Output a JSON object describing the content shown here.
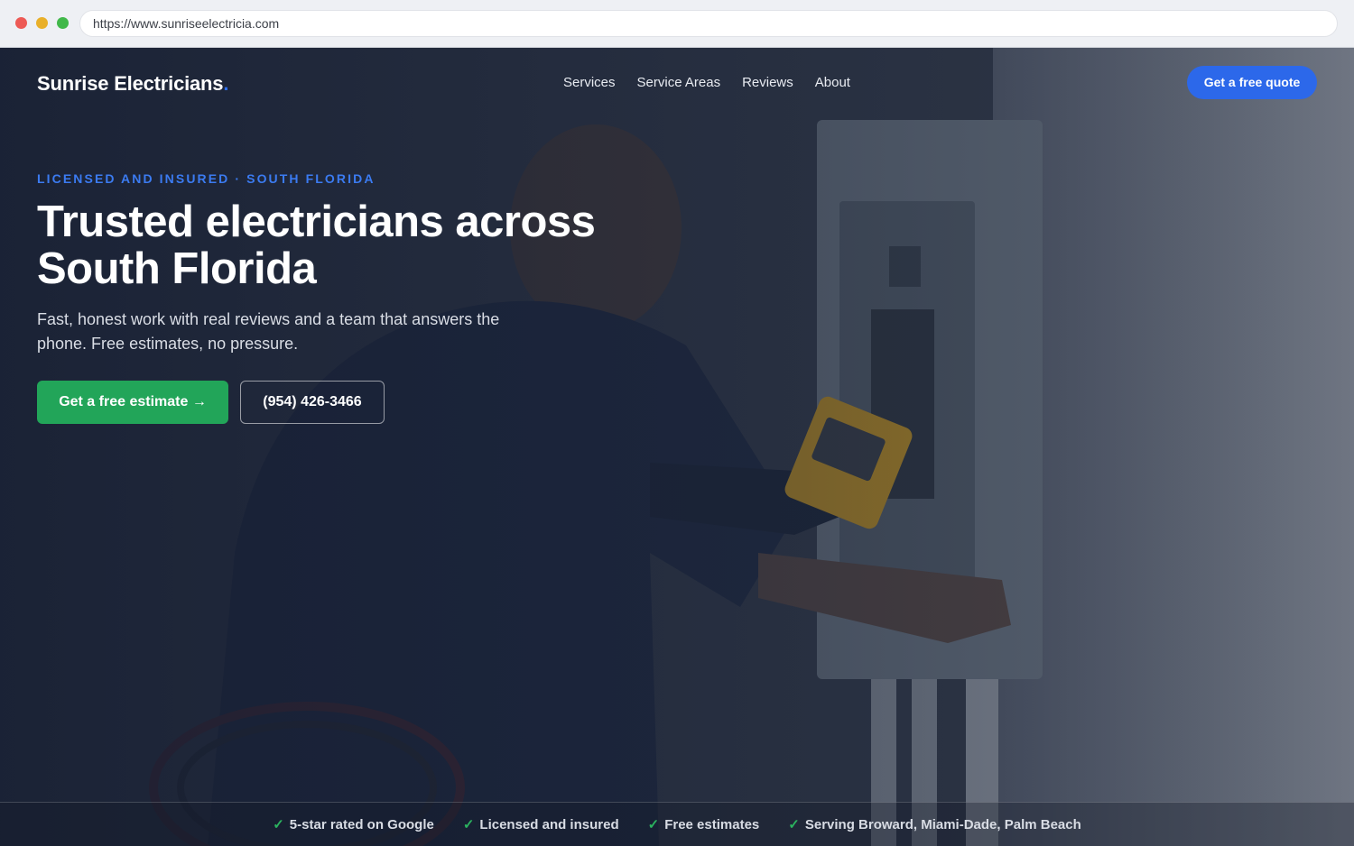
{
  "browser": {
    "url": "https://www.sunriseelectricia.com"
  },
  "header": {
    "brand": "Sunrise Electricians",
    "brand_dot": ".",
    "nav": [
      {
        "label": "Services"
      },
      {
        "label": "Service Areas"
      },
      {
        "label": "Reviews"
      },
      {
        "label": "About"
      }
    ],
    "cta_label": "Get a free quote"
  },
  "hero": {
    "eyebrow": "LICENSED AND INSURED · SOUTH FLORIDA",
    "headline_line1": "Trusted electricians across",
    "headline_line2": "South Florida",
    "subtitle": "Fast, honest work with real reviews and a team that answers the phone. Free estimates, no pressure.",
    "primary_button": "Get a free estimate →",
    "secondary_button": "(954) 426-3466"
  },
  "trust_bar": {
    "check_glyph": "✓",
    "items": [
      {
        "label": "5-star rated on Google"
      },
      {
        "label": "Licensed and insured"
      },
      {
        "label": "Free estimates"
      },
      {
        "label": "Serving Broward, Miami-Dade, Palm Beach"
      }
    ]
  },
  "colors": {
    "accent_blue": "#2c68ea",
    "eyebrow_blue": "#3b7bf1",
    "cta_green": "#22a559",
    "check_green": "#2bb35f"
  }
}
